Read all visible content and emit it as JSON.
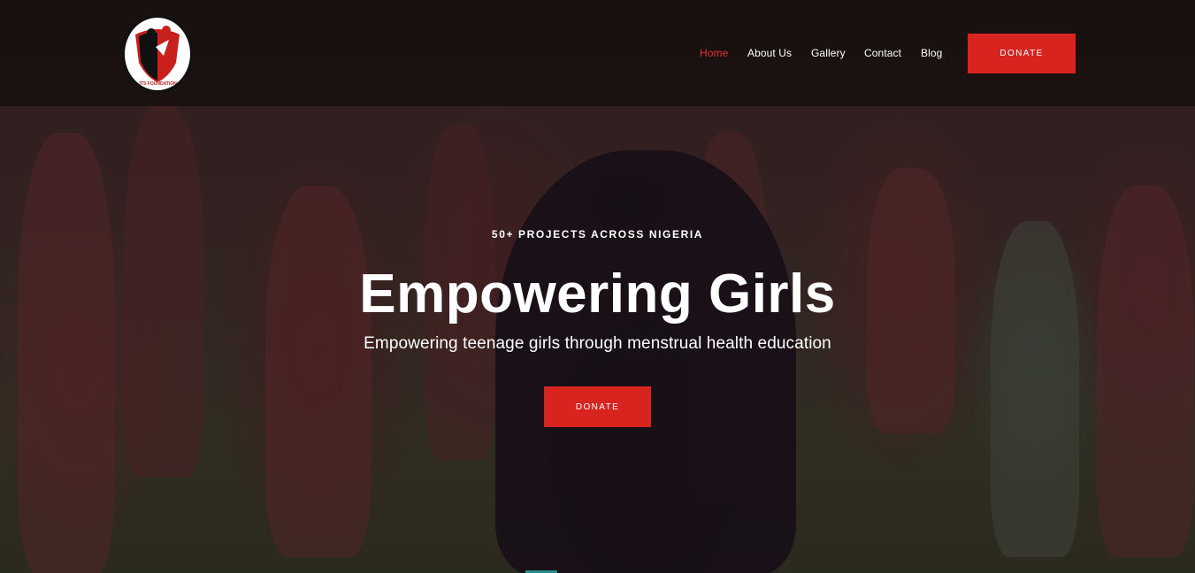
{
  "brand": {
    "logo_text": "JTS FOUNDATION",
    "logo_alt": "JTS Foundation logo"
  },
  "nav": {
    "items": [
      {
        "label": "Home",
        "active": true
      },
      {
        "label": "About Us",
        "active": false
      },
      {
        "label": "Gallery",
        "active": false
      },
      {
        "label": "Contact",
        "active": false
      },
      {
        "label": "Blog",
        "active": false
      }
    ],
    "donate_label": "DONATE"
  },
  "hero": {
    "kicker": "50+ PROJECTS ACROSS NIGERIA",
    "headline": "Empowering Girls",
    "subline": "Empowering teenage girls through menstrual health education",
    "donate_label": "DONATE",
    "background": "photo-of-schoolgirls-in-maroon-uniforms"
  },
  "colors": {
    "accent": "#d8231f",
    "active_nav": "#e2322c",
    "navbar_bg": "#18100f"
  }
}
